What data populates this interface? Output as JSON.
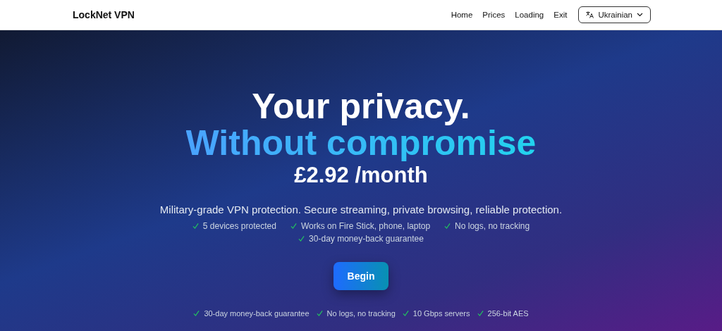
{
  "header": {
    "brand": "LockNet VPN",
    "nav": [
      {
        "label": "Home"
      },
      {
        "label": "Prices"
      },
      {
        "label": "Loading"
      },
      {
        "label": "Exit"
      }
    ],
    "language": "Ukrainian"
  },
  "hero": {
    "title": "Your privacy.",
    "highlight": "Without compromise",
    "price": "£2.92 /month",
    "subtitle": "Military-grade VPN protection. Secure streaming, private browsing, reliable protection.",
    "features": [
      "5 devices protected",
      "Works on Fire Stick, phone, laptop",
      "No logs, no tracking",
      "30-day money-back guarantee"
    ],
    "button": "Begin",
    "badges": [
      "30-day money-back guarantee",
      "No logs, no tracking",
      "10 Gbps servers",
      "256-bit AES"
    ]
  }
}
